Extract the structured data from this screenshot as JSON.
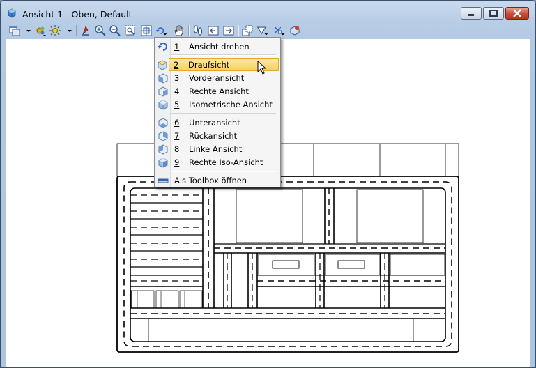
{
  "window": {
    "title": "Ansicht 1 - Oben, Default",
    "controls": [
      "minimize",
      "maximize",
      "close"
    ]
  },
  "toolbar": {
    "icons": [
      "view-attributes-icon",
      "dropdown-arrow-icon",
      "display-style-icon",
      "lighting-icon",
      "dropdown-arrow-icon",
      "update-view-icon",
      "zoom-in-icon",
      "zoom-out-icon",
      "window-area-icon",
      "fit-view-icon",
      "rotate-view-icon",
      "pan-view-icon",
      "walk-icon",
      "previous-view-icon",
      "next-view-icon",
      "copy-view-icon",
      "clip-volume-icon",
      "clip-mask-icon",
      "render-icon"
    ]
  },
  "menu": {
    "items": [
      {
        "num": "1",
        "label": "Ansicht drehen",
        "icon": "rotate-view-icon"
      },
      {
        "num": "2",
        "label": "Draufsicht",
        "icon": "top-view-cube-icon",
        "selected": true
      },
      {
        "num": "3",
        "label": "Vorderansicht",
        "icon": "front-view-cube-icon"
      },
      {
        "num": "4",
        "label": "Rechte Ansicht",
        "icon": "right-view-cube-icon"
      },
      {
        "num": "5",
        "label": "Isometrische Ansicht",
        "icon": "iso-view-cube-icon"
      },
      {
        "num": "6",
        "label": "Unteransicht",
        "icon": "bottom-view-cube-icon"
      },
      {
        "num": "7",
        "label": "Rückansicht",
        "icon": "back-view-cube-icon"
      },
      {
        "num": "8",
        "label": "Linke Ansicht",
        "icon": "left-view-cube-icon"
      },
      {
        "num": "9",
        "label": "Rechte Iso-Ansicht",
        "icon": "right-iso-view-cube-icon"
      },
      {
        "num": "",
        "label": "Als Toolbox öffnen",
        "icon": "toolbox-icon"
      }
    ]
  },
  "colors": {
    "titlebar": "#b9cde5",
    "highlight": "#f9cf5f",
    "close_button": "#c8513b",
    "canvas": "#ffffff"
  }
}
